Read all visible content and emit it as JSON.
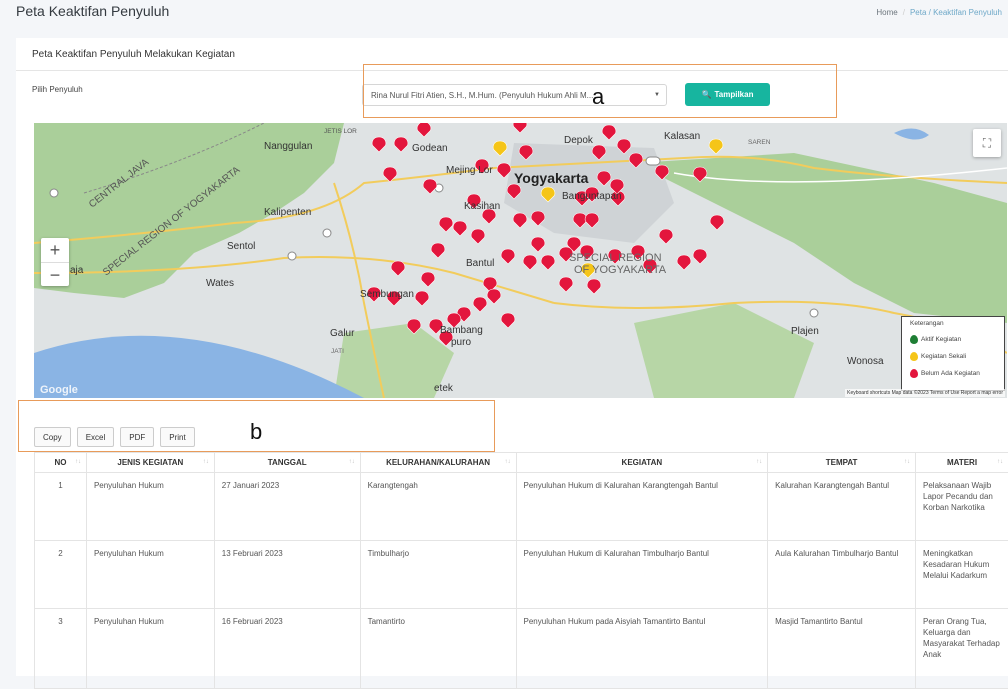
{
  "header": {
    "page_title": "Peta Keaktifan Penyuluh",
    "breadcrumb": {
      "home": "Home",
      "separator": "/",
      "current": "Peta / Keaktifan Penyuluh"
    }
  },
  "card": {
    "title": "Peta Keaktifan Penyuluh Melakukan Kegiatan",
    "pilih_label": "Pilih Penyuluh",
    "select_value": "Rina Nurul Fitri Atien, S.H., M.Hum. (Penyuluh Hukum Ahli M...",
    "show_button": "Tampilkan"
  },
  "annotations": {
    "a": "a",
    "b": "b"
  },
  "map": {
    "labels": {
      "jetis": "JETIS LOR",
      "nanggulan": "Nanggulan",
      "godean": "Godean",
      "mejing": "Mejing Lor",
      "yogya": "Yogyakarta",
      "depok": "Depok",
      "kalasan": "Kalasan",
      "saren": "SAREN",
      "central_java": "CENTRAL JAVA",
      "special_region_diag": "SPECIAL REGION OF YOGYAKARTA",
      "kalipenten": "Kalipenten",
      "banguntapan": "Banguntapan",
      "kasihan": "Kasihan",
      "sentol": "Sentol",
      "bantul": "Bantul",
      "special_region": "SPECIAL REGION",
      "of_yogyakarta": "OF YOGYAKARTA",
      "jaja": "aja",
      "wates": "Wates",
      "sembungan": "Sembungan",
      "galur": "Galur",
      "jati": "JATI",
      "bambanglipuro": "Bambang",
      "puro": "puro",
      "imogiri": "etek",
      "plajen": "Plajen",
      "wonosari": "Wonosa"
    },
    "google": "Google",
    "attribution": "Keyboard shortcuts   Map data ©2023   Terms of Use   Report a map error",
    "legend": {
      "title": "Keterangan",
      "items": [
        {
          "label": "Aktif Kegiatan",
          "color": "#1e7e34"
        },
        {
          "label": "Kegiatan Sekali",
          "color": "#f5c518"
        },
        {
          "label": "Belum Ada Kegiatan",
          "color": "#e3163d"
        }
      ]
    },
    "zoom_in": "+",
    "zoom_out": "−",
    "fullscreen": "⛶"
  },
  "export_buttons": [
    "Copy",
    "Excel",
    "PDF",
    "Print"
  ],
  "table": {
    "headers": [
      "NO",
      "JENIS KEGIATAN",
      "TANGGAL",
      "KELURAHAN/KALURAHAN",
      "KEGIATAN",
      "TEMPAT",
      "MATERI"
    ],
    "rows": [
      [
        "1",
        "Penyuluhan Hukum",
        "27 Januari 2023",
        "Karangtengah",
        "Penyuluhan Hukum di Kalurahan Karangtengah Bantul",
        "Kalurahan Karangtengah Bantul",
        "Pelaksanaan Wajib Lapor Pecandu dan Korban Narkotika"
      ],
      [
        "2",
        "Penyuluhan Hukum",
        "13 Februari 2023",
        "Timbulharjo",
        "Penyuluhan Hukum di Kalurahan Timbulharjo Bantul",
        "Aula Kalurahan Timbulharjo Bantul",
        "Meningkatkan Kesadaran Hukum Melalui Kadarkum"
      ],
      [
        "3",
        "Penyuluhan Hukum",
        "16 Februari 2023",
        "Tamantirto",
        "Penyuluhan Hukum pada Aisyiah Tamantirto Bantul",
        "Masjid Tamantirto Bantul",
        "Peran Orang Tua, Keluarga dan Masyarakat Terhadap Anak"
      ]
    ]
  }
}
